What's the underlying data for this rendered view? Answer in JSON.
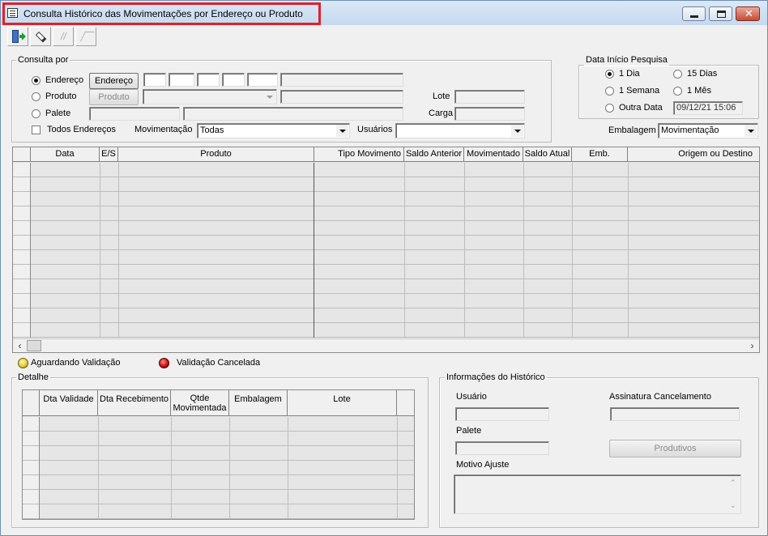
{
  "window": {
    "title": "Consulta Histórico das Movimentações por Endereço ou Produto",
    "controls": {
      "minimize": "minimize",
      "maximize": "maximize",
      "close": "close"
    }
  },
  "toolbar": {
    "icons": [
      "exit-icon",
      "eraser-icon",
      "disabled-tool-icon",
      "disabled-tool-icon"
    ]
  },
  "consulta": {
    "group_label": "Consulta por",
    "endereco": {
      "label": "Endereço",
      "button": "Endereço",
      "selected": true
    },
    "produto": {
      "label": "Produto",
      "button": "Produto",
      "selected": false
    },
    "palete": {
      "label": "Palete",
      "selected": false
    },
    "todos_enderecos": {
      "label": "Todos Endereços",
      "checked": false
    },
    "lote_label": "Lote",
    "carga_label": "Carga",
    "movimentacao": {
      "label": "Movimentação",
      "value": "Todas"
    },
    "usuarios": {
      "label": "Usuários",
      "value": ""
    }
  },
  "data_inicio": {
    "group_label": "Data Início Pesquisa",
    "options": [
      {
        "label": "1 Dia",
        "selected": true
      },
      {
        "label": "15 Dias",
        "selected": false
      },
      {
        "label": "1 Semana",
        "selected": false
      },
      {
        "label": "1 Mês",
        "selected": false
      },
      {
        "label": "Outra Data",
        "selected": false
      }
    ],
    "date_value": "09/12/21 15:06"
  },
  "embalagem": {
    "label": "Embalagem",
    "value": "Movimentação"
  },
  "main_grid": {
    "columns": [
      "Data",
      "E/S",
      "Produto",
      "Tipo Movimento",
      "Saldo Anterior",
      "Movimentado",
      "Saldo Atual",
      "Emb.",
      "Origem ou Destino"
    ]
  },
  "legend": {
    "aguardando": "Aguardando Validação",
    "cancelada": "Validação Cancelada",
    "colors": {
      "aguardando": "#e4cf3c",
      "cancelada": "#d01010"
    }
  },
  "detalhe": {
    "group_label": "Detalhe",
    "columns": [
      "Dta Validade",
      "Dta Recebimento",
      "Qtde Movimentada",
      "Embalagem",
      "Lote"
    ]
  },
  "info": {
    "group_label": "Informações do Histórico",
    "usuario_label": "Usuário",
    "palete_label": "Palete",
    "motivo_label": "Motivo Ajuste",
    "assinatura_label": "Assinatura Cancelamento",
    "produtivos_button": "Produtivos"
  }
}
